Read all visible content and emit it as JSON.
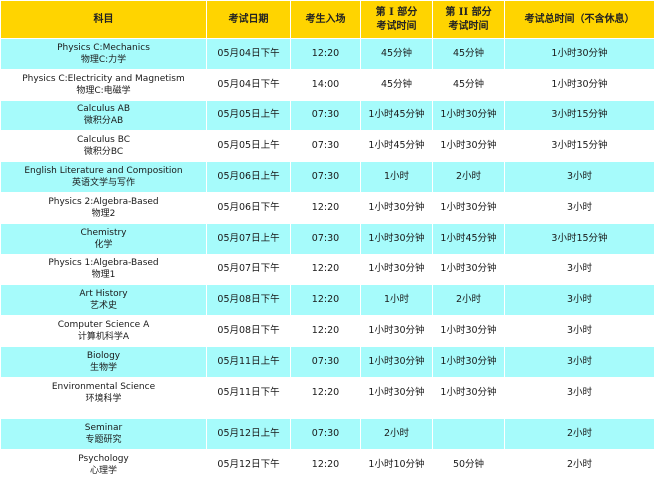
{
  "headers": [
    "科目",
    "考试日期",
    "考生入场",
    "第 I 部分\n考试时间",
    "第 II 部分\n考试时间",
    "考试总时间（不含休息）"
  ],
  "rows": [
    {
      "en": "Physics C:Mechanics",
      "cn": "物理C:力学",
      "date": "05月04日下午",
      "entry": "12:20",
      "part1": "45分钟",
      "part2": "45分钟",
      "total": "1小时30分钟"
    },
    {
      "en": "Physics C:Electricity and Magnetism",
      "cn": "物理C:电磁学",
      "date": "05月04日下午",
      "entry": "14:00",
      "part1": "45分钟",
      "part2": "45分钟",
      "total": "1小时30分钟"
    },
    {
      "en": "Calculus AB",
      "cn": "微积分AB",
      "date": "05月05日上午",
      "entry": "07:30",
      "part1": "1小时45分钟",
      "part2": "1小时30分钟",
      "total": "3小时15分钟"
    },
    {
      "en": "Calculus BC",
      "cn": "微积分BC",
      "date": "05月05日上午",
      "entry": "07:30",
      "part1": "1小时45分钟",
      "part2": "1小时30分钟",
      "total": "3小时15分钟"
    },
    {
      "en": "English Literature and Composition",
      "cn": "英语文学与写作",
      "date": "05月06日上午",
      "entry": "07:30",
      "part1": "1小时",
      "part2": "2小时",
      "total": "3小时"
    },
    {
      "en": "Physics 2:Algebra-Based",
      "cn": "物理2",
      "date": "05月06日下午",
      "entry": "12:20",
      "part1": "1小时30分钟",
      "part2": "1小时30分钟",
      "total": "3小时"
    },
    {
      "en": "Chemistry",
      "cn": "化学",
      "date": "05月07日上午",
      "entry": "07:30",
      "part1": "1小时30分钟",
      "part2": "1小时45分钟",
      "total": "3小时15分钟"
    },
    {
      "en": "Physics 1:Algebra-Based",
      "cn": "物理1",
      "date": "05月07日下午",
      "entry": "12:20",
      "part1": "1小时30分钟",
      "part2": "1小时30分钟",
      "total": "3小时"
    },
    {
      "en": "Art History",
      "cn": "艺术史",
      "date": "05月08日下午",
      "entry": "12:20",
      "part1": "1小时",
      "part2": "2小时",
      "total": "3小时"
    },
    {
      "en": "Computer Science A",
      "cn": "计算机科学A",
      "date": "05月08日下午",
      "entry": "12:20",
      "part1": "1小时30分钟",
      "part2": "1小时30分钟",
      "total": "3小时"
    },
    {
      "en": "Biology",
      "cn": "生物学",
      "date": "05月11日上午",
      "entry": "07:30",
      "part1": "1小时30分钟",
      "part2": "1小时30分钟",
      "total": "3小时"
    },
    {
      "en": "Environmental Science",
      "cn": "环境科学",
      "date": "05月11日下午",
      "entry": "12:20",
      "part1": "1小时30分钟",
      "part2": "1小时30分钟",
      "total": "3小时"
    }
  ],
  "extra_rows": [
    {
      "en": "Seminar",
      "cn": "专题研究",
      "date": "05月12日上午",
      "entry": "07:30",
      "part1": "2小时",
      "part2": "",
      "total": "2小时"
    },
    {
      "en": "Psychology",
      "cn": "心理学",
      "date": "05月12日下午",
      "entry": "12:20",
      "part1": "1小时10分钟",
      "part2": "50分钟",
      "total": "2小时"
    }
  ],
  "colors": {
    "header": "#ffd400",
    "cyan": "#a6fbfb",
    "white": "#ffffff"
  }
}
